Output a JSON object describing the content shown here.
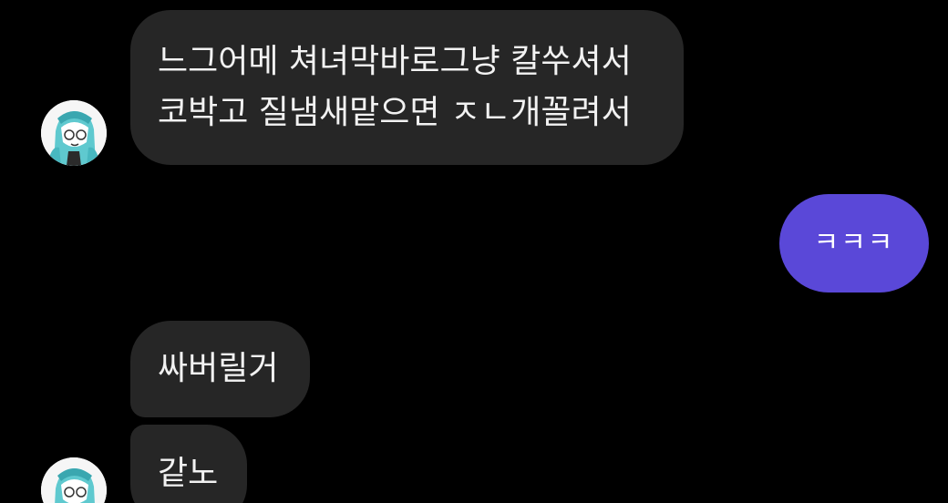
{
  "messages": [
    {
      "sender": "other",
      "lines": [
        "느그어메 쳐녀막바로그냥 칼쑤셔서",
        "코박고 질냄새맡으면 ㅈㄴ개꼴려서"
      ]
    },
    {
      "sender": "me",
      "text": "ㅋㅋㅋ"
    },
    {
      "sender": "other",
      "text": "싸버릴거"
    },
    {
      "sender": "other",
      "text": "같노"
    }
  ],
  "avatars": [
    {
      "icon": "anime-character-avatar-icon"
    },
    {
      "icon": "anime-character-avatar-icon"
    }
  ],
  "colors": {
    "background": "#000000",
    "received_bubble": "#262626",
    "sent_bubble": "#5a48d8",
    "text": "#f2f2f2"
  }
}
